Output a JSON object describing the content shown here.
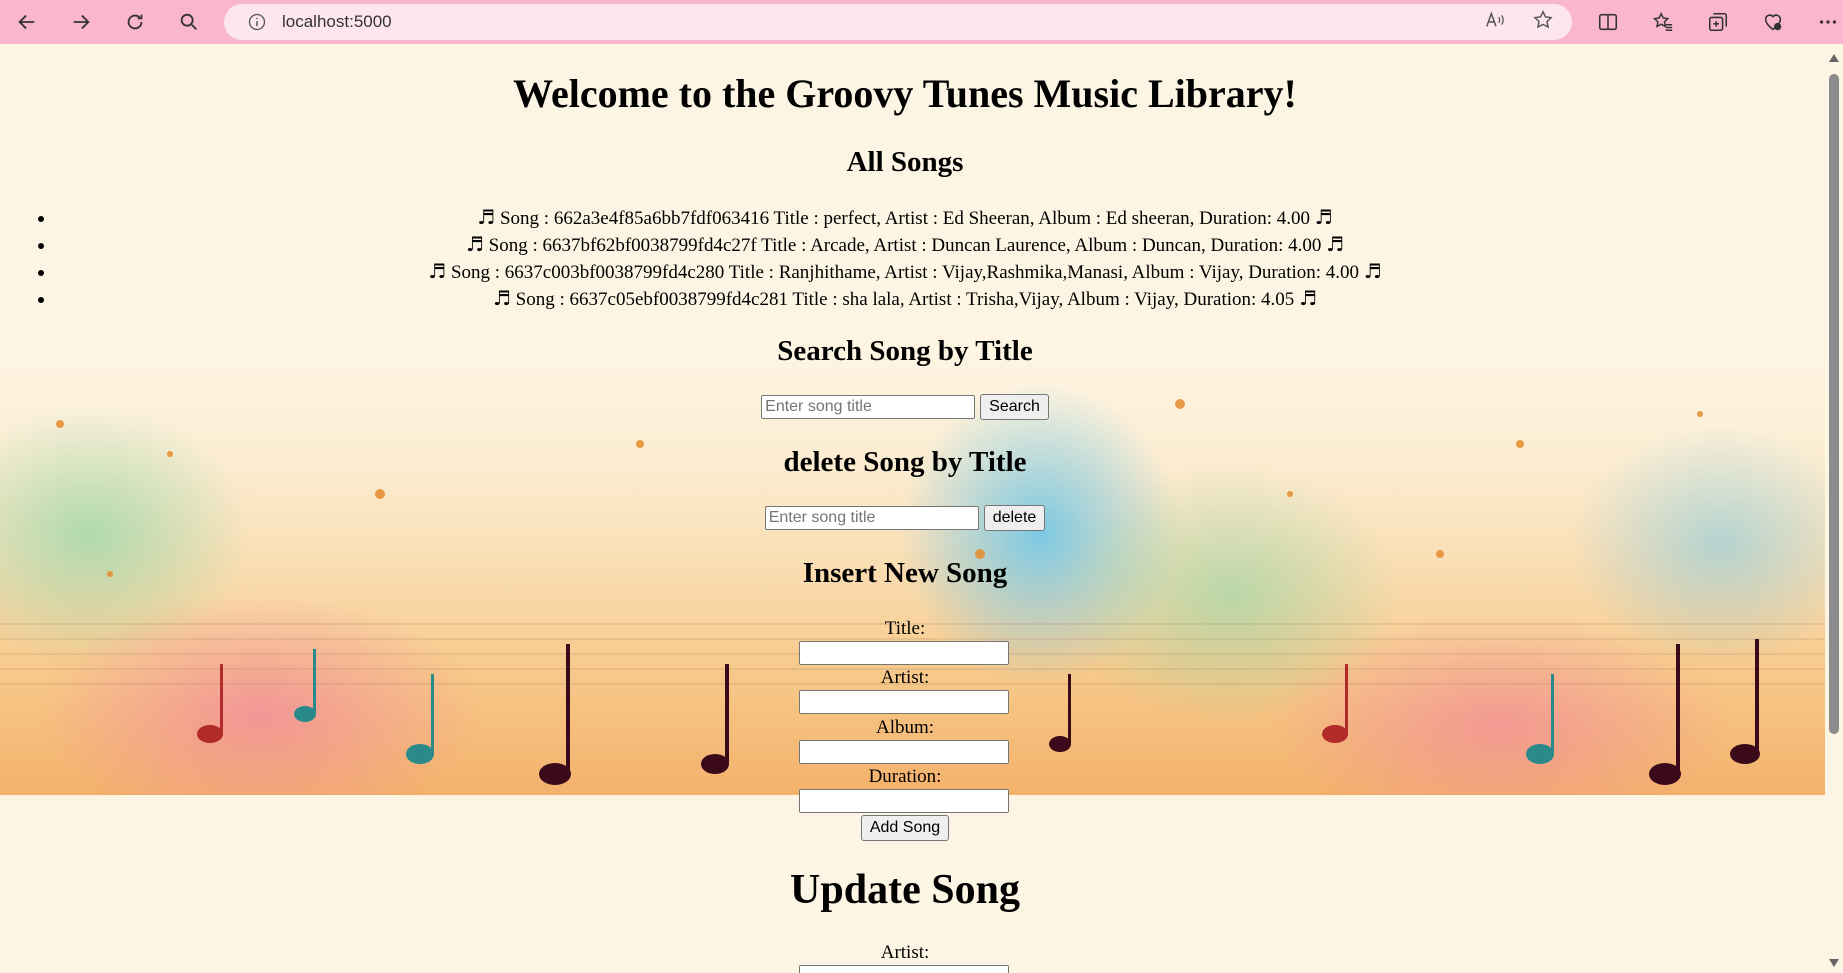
{
  "browser": {
    "url": "localhost:5000",
    "icons": [
      "back-icon",
      "forward-icon",
      "reload-icon",
      "search-icon",
      "info-icon",
      "read-aloud-icon",
      "favorite-star-icon",
      "split-screen-icon",
      "favorites-icon",
      "collections-icon",
      "browser-essentials-icon",
      "more-icon"
    ]
  },
  "page": {
    "title": "Welcome to the Groovy Tunes Music Library!",
    "all_songs_heading": "All Songs",
    "songs": [
      "Song : 662a3e4f85a6bb7fdf063416 Title : perfect, Artist : Ed Sheeran, Album : Ed sheeran, Duration: 4.00",
      "Song : 6637bf62bf0038799fd4c27f Title : Arcade, Artist : Duncan Laurence, Album : Duncan, Duration: 4.00",
      "Song : 6637c003bf0038799fd4c280 Title : Ranjhithame, Artist : Vijay,Rashmika,Manasi, Album : Vijay, Duration: 4.00",
      "Song : 6637c05ebf0038799fd4c281 Title : sha lala, Artist : Trisha,Vijay, Album : Vijay, Duration: 4.05"
    ],
    "note_glyph": "♬",
    "search": {
      "heading": "Search Song by Title",
      "placeholder": "Enter song title",
      "button": "Search"
    },
    "delete": {
      "heading": "delete Song by Title",
      "placeholder": "Enter song title",
      "button": "delete"
    },
    "insert": {
      "heading": "Insert New Song",
      "title_label": "Title:",
      "artist_label": "Artist:",
      "album_label": "Album:",
      "duration_label": "Duration:",
      "button": "Add Song"
    },
    "update": {
      "heading": "Update Song",
      "artist_label": "Artist:"
    }
  },
  "colors": {
    "chrome": "#f9b6cc",
    "urlbar": "#fde6ee",
    "page_bg": "#fdf5e4"
  }
}
